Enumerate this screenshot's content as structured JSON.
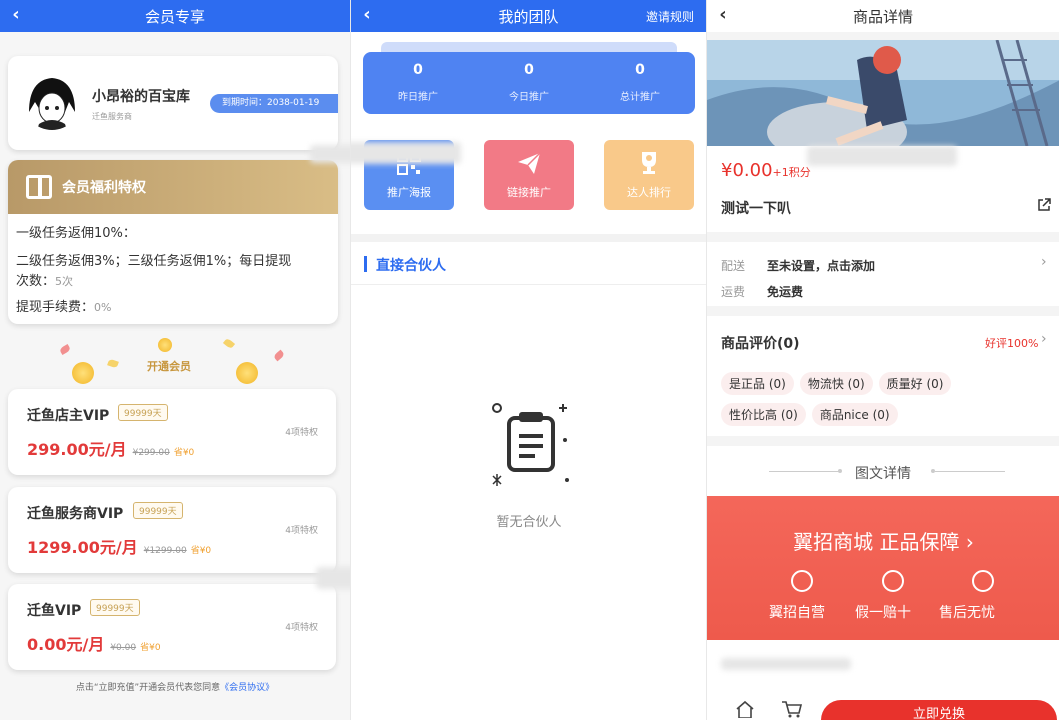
{
  "p1": {
    "title": "会员专享",
    "back": "‹",
    "profile": {
      "name": "小昂裕的百宝库",
      "role": "迁鱼服务商",
      "expire": "到期时间：2038-01-19"
    },
    "benefit": {
      "title": "会员福利特权",
      "l1": "一级任务返佣10%：",
      "l2": "二级任务返佣3%；三级任务返佣1%；每日提现",
      "l3a": "次数：",
      "l3b": "5次",
      "l4a": "提现手续费：",
      "l4b": "0%"
    },
    "open": "开通会员",
    "vips": [
      {
        "name": "迁鱼店主VIP",
        "days": "99999天",
        "price": "299.00元/月",
        "old": "¥299.00",
        "save": "省¥0",
        "priv": "4项特权"
      },
      {
        "name": "迁鱼服务商VIP",
        "days": "99999天",
        "price": "1299.00元/月",
        "old": "¥1299.00",
        "save": "省¥0",
        "priv": "4项特权"
      },
      {
        "name": "迁鱼VIP",
        "days": "99999天",
        "price": "0.00元/月",
        "old": "¥0.00",
        "save": "省¥0",
        "priv": "4项特权"
      }
    ],
    "footer_a": "点击“立即充值”开通会员代表您同意",
    "footer_b": "《会员协议》"
  },
  "p2": {
    "title": "我的团队",
    "back": "‹",
    "right": "邀请规则",
    "stats": [
      {
        "value": "0",
        "label": "昨日推广"
      },
      {
        "value": "0",
        "label": "今日推广"
      },
      {
        "value": "0",
        "label": "总计推广"
      }
    ],
    "tiles": [
      {
        "label": "推广海报",
        "color": "#5a8ff2"
      },
      {
        "label": "链接推广",
        "color": "#f27a86"
      },
      {
        "label": "达人排行",
        "color": "#f9c98a"
      }
    ],
    "section": "直接合伙人",
    "empty": "暂无合伙人"
  },
  "p3": {
    "title": "商品详情",
    "back": "‹",
    "price": "¥0.00",
    "points": "+1积分",
    "name": "测试一下叭",
    "ship_label": "配送",
    "ship_value": "至未设置，点击添加",
    "fee_label": "运费",
    "fee_value": "免运费",
    "review_title": "商品评价(0)",
    "review_rate": "好评100%",
    "tags": [
      "是正品 (0)",
      "物流快 (0)",
      "质量好 (0)",
      "性价比高 (0)",
      "商品nice (0)"
    ],
    "detail_title": "图文详情",
    "banner_title": "翼招商城 正品保障",
    "banner_items": [
      "翼招自营",
      "假一赔十",
      "售后无忧"
    ],
    "buy": "立即兑换"
  }
}
